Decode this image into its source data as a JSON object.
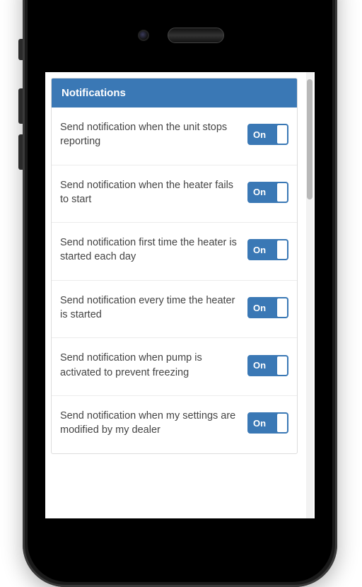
{
  "panel": {
    "title": "Notifications"
  },
  "toggle": {
    "on_label": "On"
  },
  "rows": [
    {
      "label": "Send notification when the unit stops reporting",
      "state": "On"
    },
    {
      "label": "Send notification when the heater fails to start",
      "state": "On"
    },
    {
      "label": "Send notification first time the heater is started each day",
      "state": "On"
    },
    {
      "label": "Send notification every time the heater is started",
      "state": "On"
    },
    {
      "label": "Send notification when pump is activated to prevent freezing",
      "state": "On"
    },
    {
      "label": "Send notification when my settings are modified by my dealer",
      "state": "On"
    }
  ]
}
